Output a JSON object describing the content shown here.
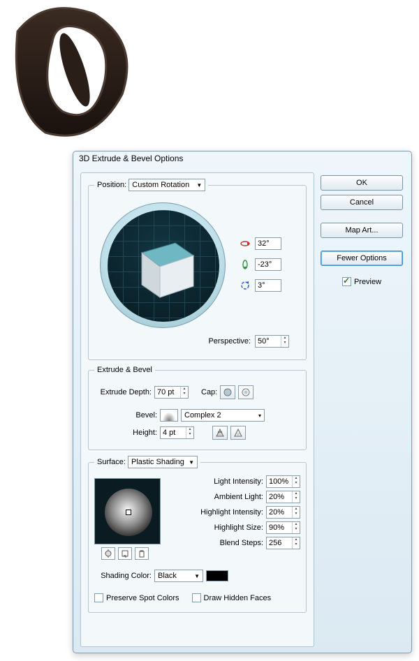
{
  "dialog_title": "3D Extrude & Bevel Options",
  "buttons": {
    "ok": "OK",
    "cancel": "Cancel",
    "map_art": "Map Art...",
    "fewer_options": "Fewer Options"
  },
  "preview": {
    "label": "Preview",
    "checked": true
  },
  "position": {
    "legend": "Position:",
    "mode": "Custom Rotation",
    "rot_x": "32°",
    "rot_y": "-23°",
    "rot_z": "3°",
    "perspective_label": "Perspective:",
    "perspective": "50°"
  },
  "extrude": {
    "legend": "Extrude & Bevel",
    "depth_label": "Extrude Depth:",
    "depth": "70 pt",
    "cap_label": "Cap:",
    "bevel_label": "Bevel:",
    "bevel": "Complex 2",
    "height_label": "Height:",
    "height": "4 pt"
  },
  "surface": {
    "legend": "Surface:",
    "mode": "Plastic Shading",
    "light_intensity_label": "Light Intensity:",
    "light_intensity": "100%",
    "ambient_label": "Ambient Light:",
    "ambient": "20%",
    "highlight_intensity_label": "Highlight Intensity:",
    "highlight_intensity": "20%",
    "highlight_size_label": "Highlight Size:",
    "highlight_size": "90%",
    "blend_steps_label": "Blend Steps:",
    "blend_steps": "256",
    "shading_color_label": "Shading Color:",
    "shading_color": "Black",
    "preserve_spot": "Preserve Spot Colors",
    "draw_hidden": "Draw Hidden Faces"
  }
}
